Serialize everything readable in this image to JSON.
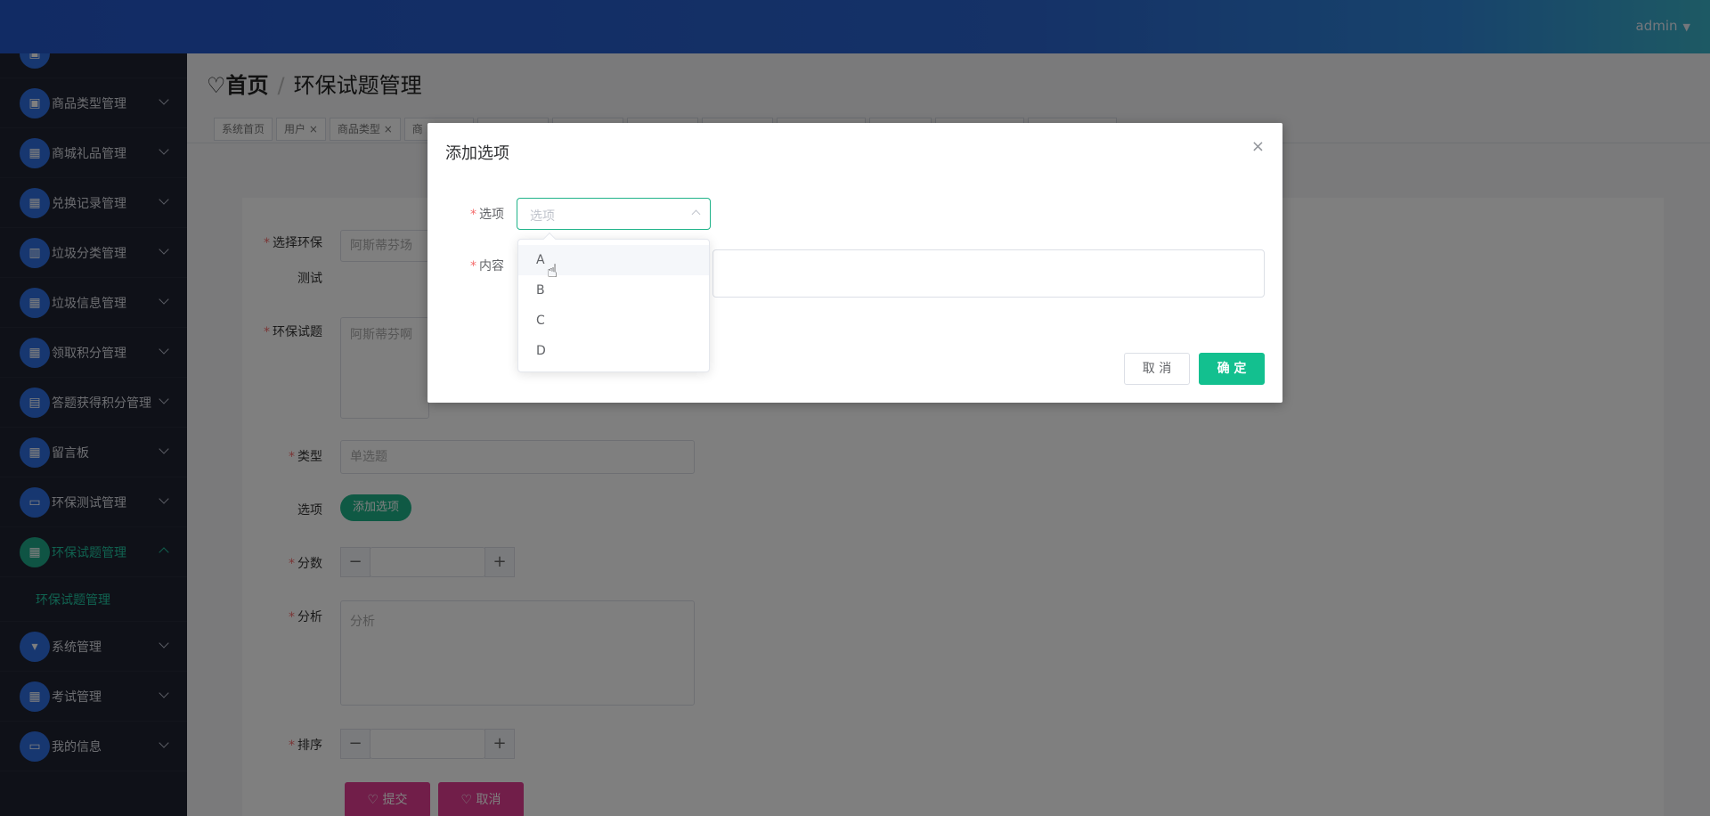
{
  "header": {
    "user": "admin",
    "caret": "▼"
  },
  "sidebar": {
    "items": [
      {
        "label": "商品类型管理",
        "icon": "briefcase-icon",
        "glyph": "▣"
      },
      {
        "label": "商城礼品管理",
        "icon": "grid-icon",
        "glyph": "▦"
      },
      {
        "label": "兑换记录管理",
        "icon": "grid-icon",
        "glyph": "▦"
      },
      {
        "label": "垃圾分类管理",
        "icon": "bar-chart-icon",
        "glyph": "▥"
      },
      {
        "label": "垃圾信息管理",
        "icon": "grid-icon",
        "glyph": "▦"
      },
      {
        "label": "领取积分管理",
        "icon": "grid-icon",
        "glyph": "▦"
      },
      {
        "label": "答题获得积分管理",
        "icon": "clipboard-icon",
        "glyph": "▤"
      },
      {
        "label": "留言板",
        "icon": "grid-icon",
        "glyph": "▦"
      },
      {
        "label": "环保测试管理",
        "icon": "monitor-icon",
        "glyph": "▭"
      },
      {
        "label": "环保试题管理",
        "icon": "grid-icon",
        "glyph": "▦"
      }
    ],
    "sub_item": "环保试题管理",
    "items_after": [
      {
        "label": "系统管理",
        "icon": "sign-icon",
        "glyph": "▾"
      },
      {
        "label": "考试管理",
        "icon": "grid-icon",
        "glyph": "▦"
      },
      {
        "label": "我的信息",
        "icon": "card-icon",
        "glyph": "▭"
      }
    ]
  },
  "breadcrumb": {
    "home": "首页",
    "current": "环保试题管理"
  },
  "tags": [
    "系统首页",
    "用户 ×",
    "商品类型 ×",
    "商",
    "",
    "",
    "",
    "",
    "",
    "",
    "",
    ""
  ],
  "form": {
    "test_label_1": "选择环保",
    "test_label_2": "测试",
    "test_value": "阿斯蒂芬场",
    "question_label": "环保试题",
    "question_value": "阿斯蒂芬啊",
    "type_label": "类型",
    "type_value": "单选题",
    "options_label": "选项",
    "add_option_btn": "添加选项",
    "score_label": "分数",
    "analysis_label": "分析",
    "analysis_placeholder": "分析",
    "order_label": "排序",
    "submit_btn": "提交",
    "cancel_btn": "取消",
    "minus": "−",
    "plus": "+"
  },
  "dialog": {
    "title": "添加选项",
    "close": "×",
    "option_label": "选项",
    "option_placeholder": "选项",
    "content_label": "内容",
    "cancel": "取 消",
    "confirm": "确 定",
    "dropdown_options": [
      "A",
      "B",
      "C",
      "D"
    ]
  },
  "colors": {
    "accent": "#13c08f",
    "header": "#2356c9",
    "sidebar": "#1f2230",
    "danger_btn": "#e23d93"
  }
}
